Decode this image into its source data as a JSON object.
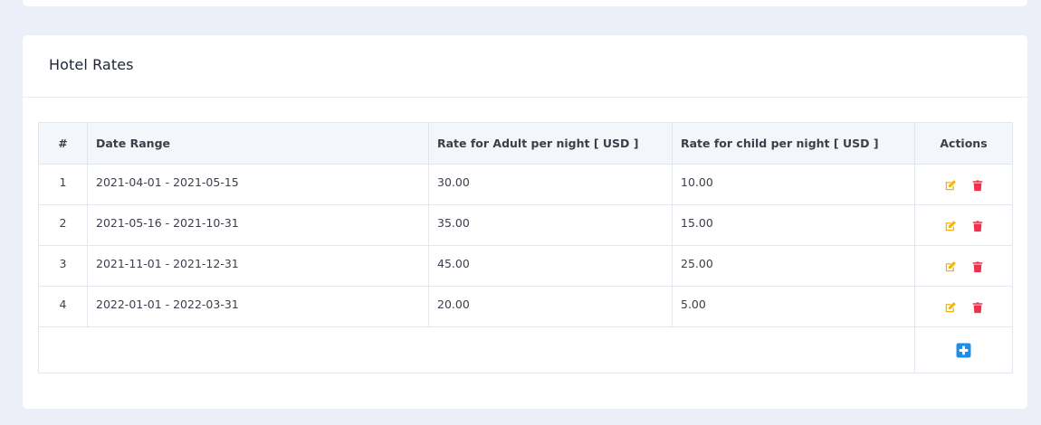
{
  "card": {
    "title": "Hotel Rates"
  },
  "table": {
    "headers": {
      "num": "#",
      "date_range": "Date Range",
      "adult_rate": "Rate for Adult per night [ USD ]",
      "child_rate": "Rate for child per night [ USD ]",
      "actions": "Actions"
    },
    "rows": [
      {
        "num": "1",
        "date_range": "2021-04-01 - 2021-05-15",
        "adult_rate": "30.00",
        "child_rate": "10.00"
      },
      {
        "num": "2",
        "date_range": "2021-05-16 - 2021-10-31",
        "adult_rate": "35.00",
        "child_rate": "15.00"
      },
      {
        "num": "3",
        "date_range": "2021-11-01 - 2021-12-31",
        "adult_rate": "45.00",
        "child_rate": "25.00"
      },
      {
        "num": "4",
        "date_range": "2022-01-01 - 2022-03-31",
        "adult_rate": "20.00",
        "child_rate": "5.00"
      }
    ]
  },
  "icons": {
    "edit": "edit-icon",
    "delete": "trash-icon",
    "add": "plus-square-icon"
  },
  "colors": {
    "page_bg": "#eceef8",
    "card_bg": "#ffffff",
    "header_bg": "#f3f6fa",
    "edit": "#f5b400",
    "delete": "#f0314c",
    "add": "#1e8fe6"
  }
}
